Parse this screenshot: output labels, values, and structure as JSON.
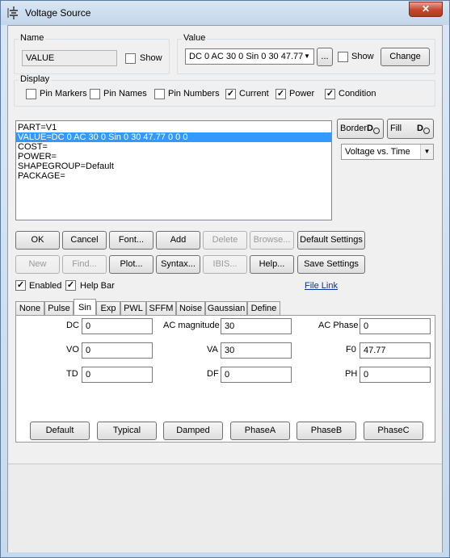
{
  "window": {
    "title": "Voltage Source",
    "close_glyph": "✕"
  },
  "name_group": {
    "legend": "Name",
    "value": "VALUE",
    "show_label": "Show"
  },
  "value_group": {
    "legend": "Value",
    "combo_value": "DC 0 AC 30 0 Sin 0 30 47.77",
    "ellipsis_label": "...",
    "show_label": "Show",
    "change_label": "Change"
  },
  "display_group": {
    "legend": "Display",
    "pin_markers": "Pin Markers",
    "pin_names": "Pin Names",
    "pin_numbers": "Pin Numbers",
    "current": "Current",
    "power": "Power",
    "condition": "Condition"
  },
  "attributes": [
    "PART=V1",
    "VALUE=DC 0 AC 30 0 Sin 0 30 47.77 0 0 0",
    "COST=",
    "POWER=",
    "SHAPEGROUP=Default",
    "PACKAGE="
  ],
  "side": {
    "border_label": "Border",
    "fill_label": "Fill",
    "plot_select": "Voltage vs. Time"
  },
  "buttons_row1": [
    "OK",
    "Cancel",
    "Font...",
    "Add",
    "Delete",
    "Browse...",
    "Default Settings"
  ],
  "buttons_row2": [
    "New",
    "Find...",
    "Plot...",
    "Syntax...",
    "IBIS...",
    "Help...",
    "Save Settings"
  ],
  "options": {
    "enabled": "Enabled",
    "help_bar": "Help Bar",
    "file_link": "File Link"
  },
  "tabs": [
    "None",
    "Pulse",
    "Sin",
    "Exp",
    "PWL",
    "SFFM",
    "Noise",
    "Gaussian",
    "Define"
  ],
  "sin_params": {
    "dc_label": "DC",
    "dc_value": "0",
    "ac_mag_label": "AC magnitude",
    "ac_mag_value": "30",
    "ac_phase_label": "AC Phase",
    "ac_phase_value": "0",
    "vo_label": "VO",
    "vo_value": "0",
    "va_label": "VA",
    "va_value": "30",
    "f0_label": "F0",
    "f0_value": "47.77",
    "td_label": "TD",
    "td_value": "0",
    "df_label": "DF",
    "df_value": "0",
    "ph_label": "PH",
    "ph_value": "0"
  },
  "preset_buttons": [
    "Default",
    "Typical",
    "Damped",
    "PhaseA",
    "PhaseB",
    "PhaseC"
  ]
}
